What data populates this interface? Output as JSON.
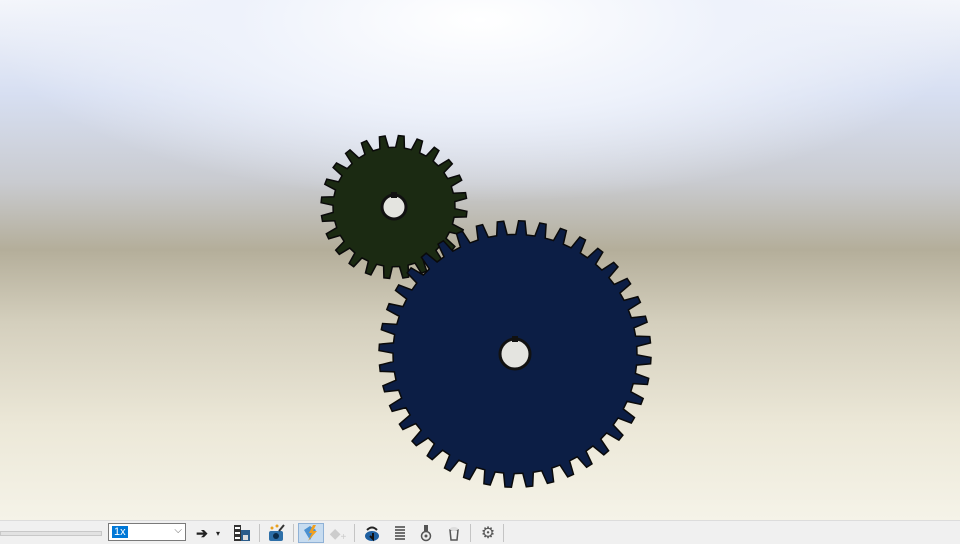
{
  "viewport": {
    "gears": [
      {
        "name": "small-gear",
        "teeth": 24,
        "color": "#1b2a12"
      },
      {
        "name": "large-gear",
        "teeth": 40,
        "color": "#0c1e45"
      }
    ]
  },
  "toolbar": {
    "playback_speed": "1x",
    "dropdown_chevron": "⌵",
    "icons": [
      "playback-mode-arrow-icon",
      "playback-mode-dropdown-icon",
      "save-animation-icon",
      "animation-wizard-icon",
      "autokey-icon",
      "add-key-icon",
      "motor-icon",
      "spring-icon",
      "contact-icon",
      "gravity-icon",
      "motion-study-properties-icon"
    ]
  }
}
